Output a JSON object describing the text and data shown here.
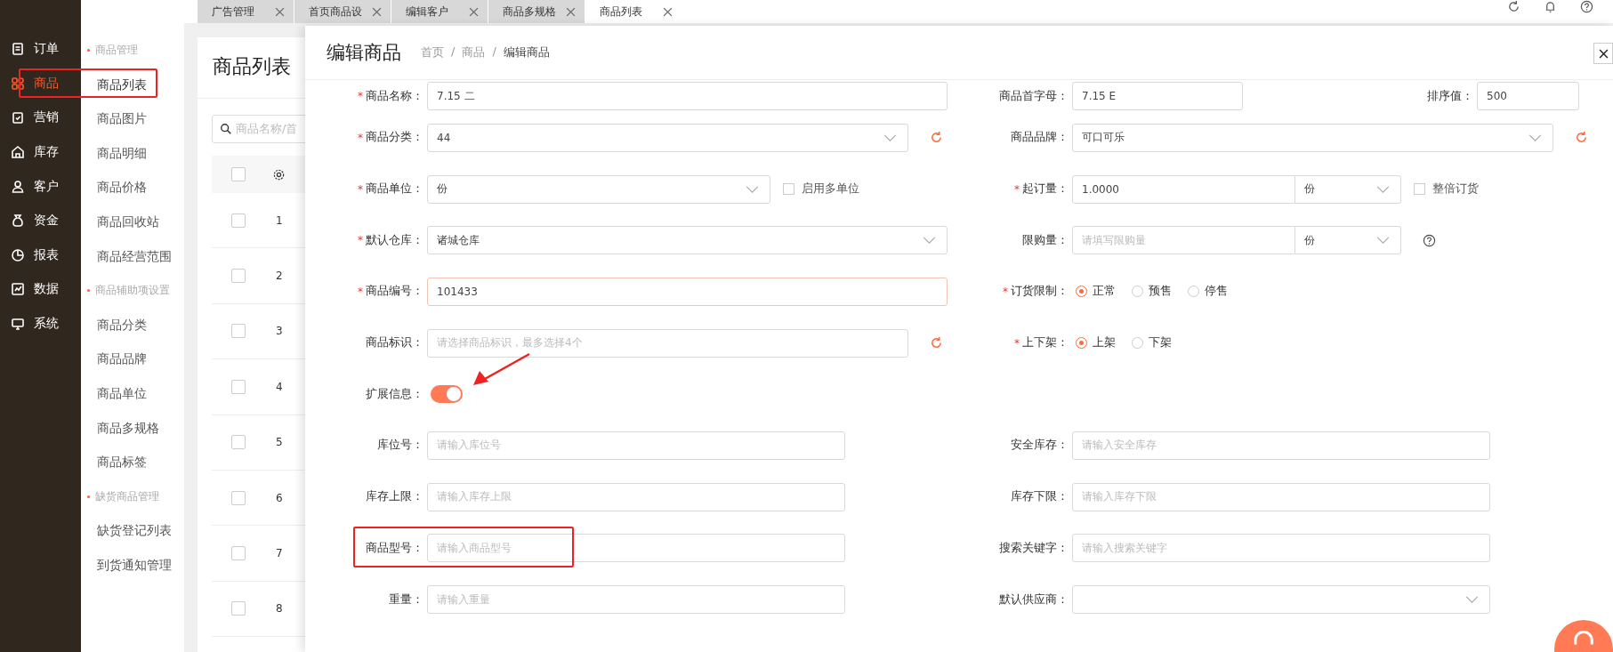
{
  "nav": {
    "items": [
      {
        "label": "订单",
        "selected": false
      },
      {
        "label": "商品",
        "selected": true
      },
      {
        "label": "营销",
        "selected": false
      },
      {
        "label": "库存",
        "selected": false
      },
      {
        "label": "客户",
        "selected": false
      },
      {
        "label": "资金",
        "selected": false
      },
      {
        "label": "报表",
        "selected": false
      },
      {
        "label": "数据",
        "selected": false
      },
      {
        "label": "系统",
        "selected": false
      }
    ]
  },
  "submenu": {
    "groups": [
      {
        "title": "商品管理",
        "items": [
          {
            "label": "商品列表",
            "selected": true
          },
          {
            "label": "商品图片",
            "selected": false
          },
          {
            "label": "商品明细",
            "selected": false
          },
          {
            "label": "商品价格",
            "selected": false
          },
          {
            "label": "商品回收站",
            "selected": false
          },
          {
            "label": "商品经营范围",
            "selected": false
          }
        ]
      },
      {
        "title": "商品辅助项设置",
        "items": [
          {
            "label": "商品分类",
            "selected": false
          },
          {
            "label": "商品品牌",
            "selected": false
          },
          {
            "label": "商品单位",
            "selected": false
          },
          {
            "label": "商品多规格",
            "selected": false
          },
          {
            "label": "商品标签",
            "selected": false
          }
        ]
      },
      {
        "title": "缺货商品管理",
        "items": [
          {
            "label": "缺货登记列表",
            "selected": false
          },
          {
            "label": "到货通知管理",
            "selected": false
          }
        ]
      }
    ]
  },
  "tabs": [
    {
      "label": "广告管理",
      "selected": false
    },
    {
      "label": "首页商品设",
      "selected": false
    },
    {
      "label": "编辑客户",
      "selected": false
    },
    {
      "label": "商品多规格",
      "selected": false
    },
    {
      "label": "商品列表",
      "selected": true
    }
  ],
  "page": {
    "title": "商品列表",
    "search": {
      "placeholder": "商品名称/首"
    },
    "all_checked": false,
    "rows": [
      {
        "index": "1",
        "checked": false
      },
      {
        "index": "2",
        "checked": false
      },
      {
        "index": "3",
        "checked": false
      },
      {
        "index": "4",
        "checked": false
      },
      {
        "index": "5",
        "checked": false
      },
      {
        "index": "6",
        "checked": false
      },
      {
        "index": "7",
        "checked": false
      },
      {
        "index": "8",
        "checked": false
      }
    ]
  },
  "drawer": {
    "title": "编辑商品",
    "breadcrumb": {
      "separator": "/",
      "items": [
        "首页",
        "商品",
        "编辑商品"
      ]
    },
    "rows": [
      {
        "cells": [
          {
            "kind": "input",
            "mark": "*",
            "label": "商品名称：",
            "value": "7.15 二"
          },
          {
            "kind": "input",
            "label": "商品首字母：",
            "value": "7.15 E"
          },
          {
            "kind": "input",
            "label": "排序值：",
            "value": "500"
          }
        ]
      },
      {
        "cells": [
          {
            "kind": "select",
            "mark": "*",
            "label": "商品分类：",
            "value": "44",
            "refresh": true
          },
          {
            "kind": "select",
            "label": "商品品牌：",
            "value": "可口可乐",
            "refresh": true
          }
        ]
      },
      {
        "cells": [
          {
            "kind": "select",
            "mark": "*",
            "label": "商品单位：",
            "value": "份",
            "check": {
              "label": "启用多单位",
              "checked": false
            }
          },
          {
            "kind": "unit",
            "mark": "*",
            "label": "起订量：",
            "value": "1.0000",
            "unit": "份",
            "check": {
              "label": "整倍订货",
              "checked": false
            }
          }
        ]
      },
      {
        "cells": [
          {
            "kind": "select",
            "mark": "*",
            "label": "默认仓库：",
            "value": "诸城仓库"
          },
          {
            "kind": "unit",
            "label": "限购量：",
            "placeholder": "请填写限购量",
            "unit": "份",
            "help": true
          }
        ]
      },
      {
        "cells": [
          {
            "kind": "input",
            "mark": "*",
            "label": "商品编号：",
            "value": "101433",
            "highlighted": true
          },
          {
            "kind": "radio",
            "mark": "*",
            "label": "订货限制：",
            "options": [
              {
                "label": "正常",
                "selected": true
              },
              {
                "label": "预售",
                "selected": false
              },
              {
                "label": "停售",
                "selected": false
              }
            ]
          }
        ]
      },
      {
        "cells": [
          {
            "kind": "input",
            "label": "商品标识：",
            "placeholder": "请选择商品标识，最多选择4个",
            "refresh": true
          },
          {
            "kind": "radio",
            "mark": "*",
            "label": "上下架：",
            "options": [
              {
                "label": "上架",
                "selected": true
              },
              {
                "label": "下架",
                "selected": false
              }
            ]
          }
        ]
      },
      {
        "cells": [
          {
            "kind": "switch",
            "label": "扩展信息：",
            "on": true
          }
        ]
      },
      {
        "cells": [
          {
            "kind": "input",
            "label": "库位号：",
            "placeholder": "请输入库位号"
          },
          {
            "kind": "input",
            "label": "安全库存：",
            "placeholder": "请输入安全库存"
          }
        ]
      },
      {
        "cells": [
          {
            "kind": "input",
            "label": "库存上限：",
            "placeholder": "请输入库存上限"
          },
          {
            "kind": "input",
            "label": "库存下限：",
            "placeholder": "请输入库存下限"
          }
        ]
      },
      {
        "cells": [
          {
            "kind": "input",
            "label": "商品型号：",
            "placeholder": "请输入商品型号"
          },
          {
            "kind": "input",
            "label": "搜索关键字：",
            "placeholder": "请输入搜索关键字"
          }
        ]
      },
      {
        "cells": [
          {
            "kind": "input",
            "label": "重量：",
            "placeholder": "请输入重量"
          },
          {
            "kind": "select",
            "label": "默认供应商："
          }
        ]
      }
    ]
  }
}
